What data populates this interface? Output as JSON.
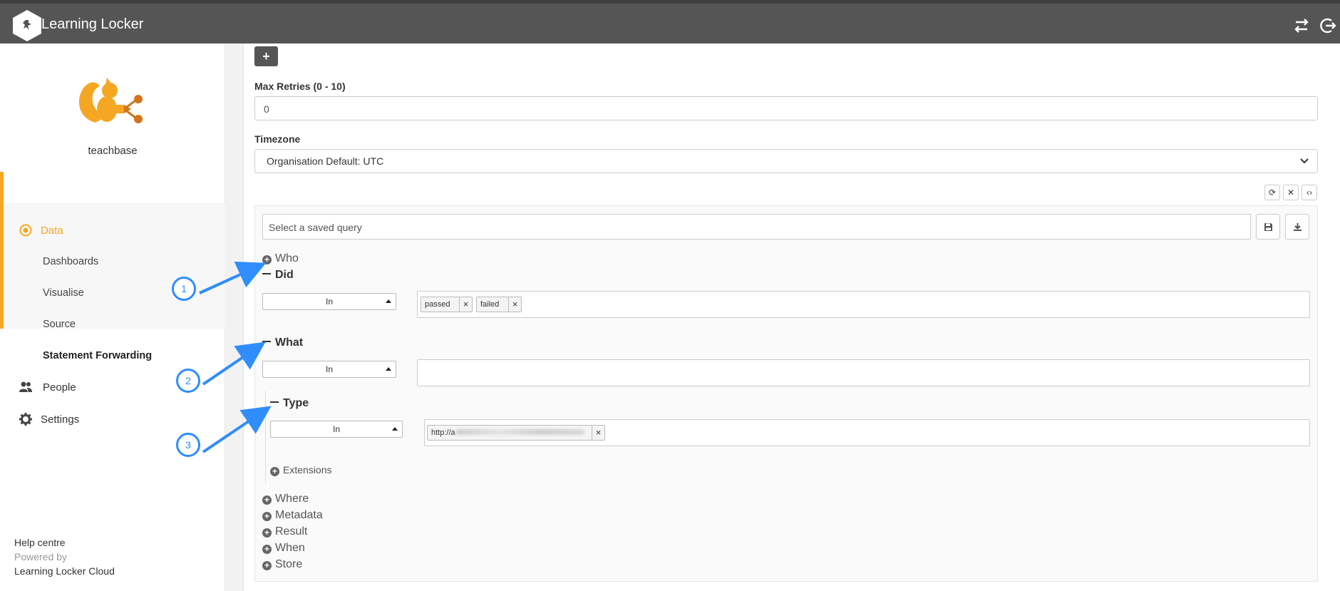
{
  "app": {
    "brand": "Learning Locker"
  },
  "topbar": {
    "icons": [
      "swap-icon",
      "logout-icon"
    ]
  },
  "sidebar": {
    "org_name": "teachbase",
    "nav": {
      "data": "Data",
      "dashboards": "Dashboards",
      "visualise": "Visualise",
      "source": "Source",
      "statement_forwarding": "Statement Forwarding",
      "people": "People",
      "settings": "Settings"
    },
    "footer": {
      "help": "Help centre",
      "powered_by": "Powered by",
      "cloud": "Learning Locker Cloud"
    }
  },
  "form": {
    "add_button": "+",
    "max_retries": {
      "label": "Max Retries (0 - 10)",
      "value": "0"
    },
    "timezone": {
      "label": "Timezone",
      "value": "Organisation Default: UTC"
    }
  },
  "query": {
    "saved_query_placeholder": "Select a saved query",
    "toolbar": {
      "refresh": "⟳",
      "clear": "✕",
      "code": "‹›"
    },
    "sections": {
      "who": "Who",
      "did": "Did",
      "what": "What",
      "type": "Type",
      "extensions": "Extensions",
      "where": "Where",
      "metadata": "Metadata",
      "result": "Result",
      "when": "When",
      "store": "Store"
    },
    "did_operator": "In",
    "did_tokens": [
      "passed",
      "failed"
    ],
    "what_operator": "In",
    "type_operator": "In",
    "type_tokens": [
      "http://a"
    ]
  },
  "annotations": [
    "1",
    "2",
    "3"
  ],
  "colors": {
    "accent": "#f5a623",
    "annotation": "#2f8dfc",
    "topbar": "#555556"
  }
}
